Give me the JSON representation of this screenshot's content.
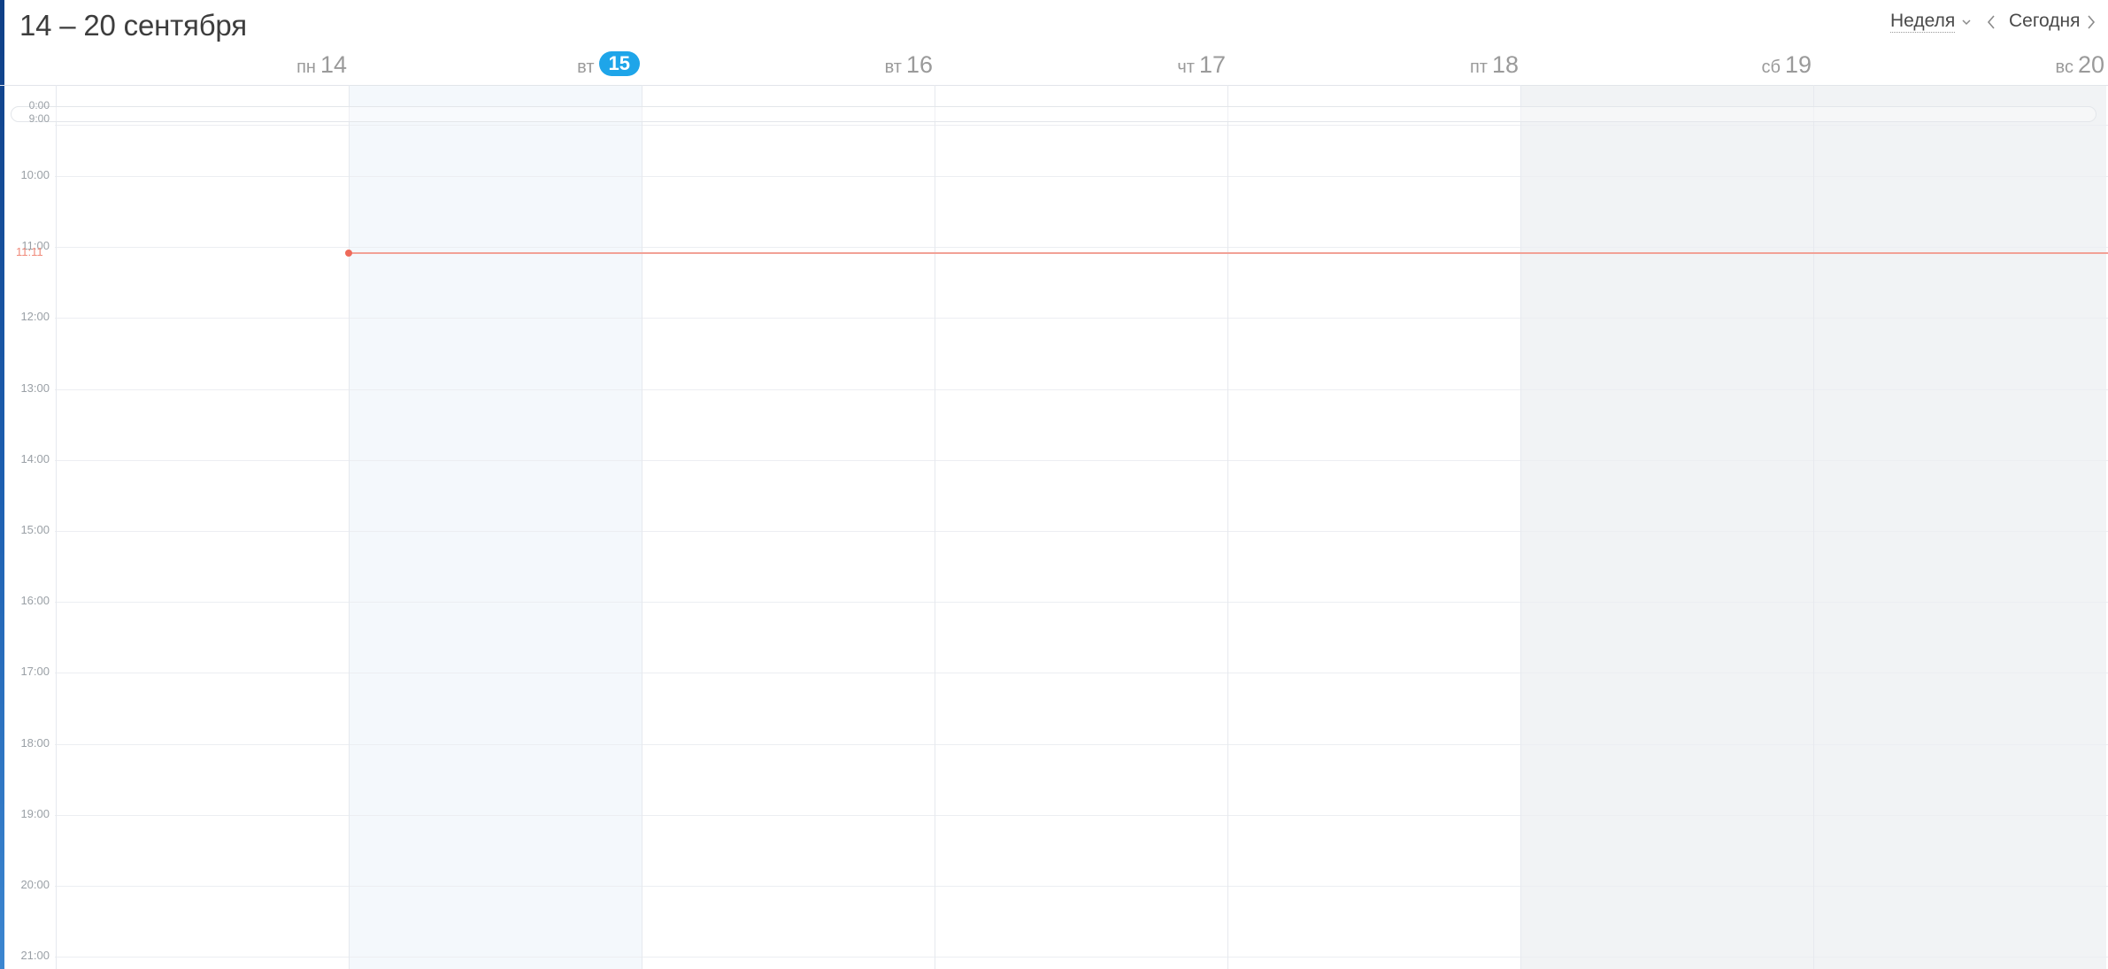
{
  "header": {
    "range_title": "14 – 20 сентября",
    "view_label": "Неделя",
    "today_label": "Сегодня"
  },
  "days": [
    {
      "dow": "пн",
      "num": "14",
      "today": false,
      "weekend": false
    },
    {
      "dow": "вт",
      "num": "15",
      "today": true,
      "weekend": false
    },
    {
      "dow": "вт",
      "num": "16",
      "today": false,
      "weekend": false
    },
    {
      "dow": "чт",
      "num": "17",
      "today": false,
      "weekend": false
    },
    {
      "dow": "пт",
      "num": "18",
      "today": false,
      "weekend": false
    },
    {
      "dow": "сб",
      "num": "19",
      "today": false,
      "weekend": true
    },
    {
      "dow": "вс",
      "num": "20",
      "today": false,
      "weekend": true
    }
  ],
  "allday_labels": [
    "0:00",
    "9:00"
  ],
  "hours": [
    "10:00",
    "11:00",
    "12:00",
    "13:00",
    "14:00",
    "15:00",
    "16:00",
    "17:00",
    "18:00",
    "19:00",
    "20:00",
    "21:00"
  ],
  "current_time": "11:11",
  "colors": {
    "accent": "#1ea5e9",
    "now_line": "#ee6a5a",
    "today_column": "#f4f8fc",
    "weekend_column": "#f1f3f5"
  }
}
